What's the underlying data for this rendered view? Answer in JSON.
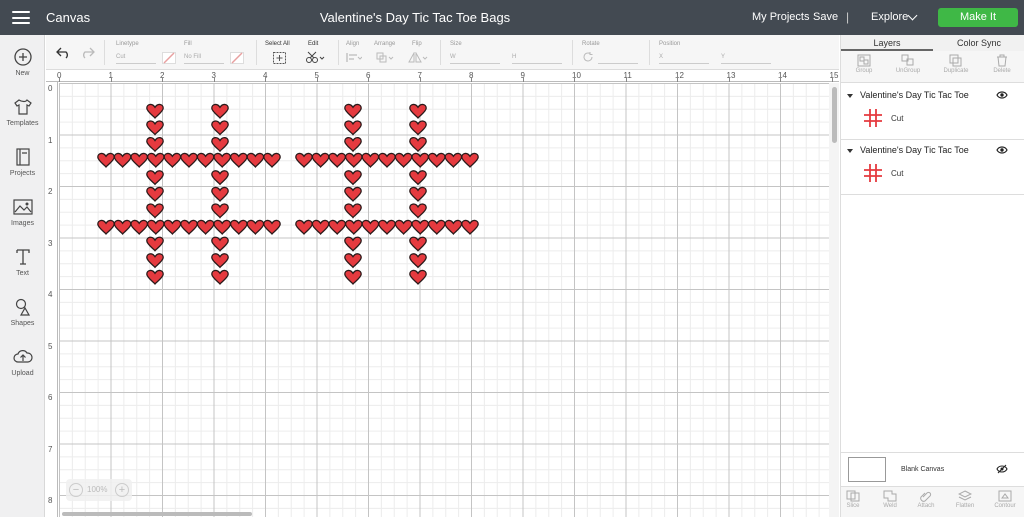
{
  "header": {
    "app_title": "Canvas",
    "project_title": "Valentine's Day Tic Tac Toe Bags",
    "my_projects": "My Projects",
    "save": "Save",
    "separator": "|",
    "explore": "Explore",
    "make_it": "Make It"
  },
  "sidebar": {
    "items": [
      {
        "label": "New",
        "icon": "plus-circle-icon"
      },
      {
        "label": "Templates",
        "icon": "shirt-icon"
      },
      {
        "label": "Projects",
        "icon": "book-icon"
      },
      {
        "label": "Images",
        "icon": "image-icon"
      },
      {
        "label": "Text",
        "icon": "text-icon"
      },
      {
        "label": "Shapes",
        "icon": "shapes-icon"
      },
      {
        "label": "Upload",
        "icon": "cloud-upload-icon"
      }
    ]
  },
  "toolbar": {
    "linetype_label": "Linetype",
    "linetype_value": "Cut",
    "fill_label": "Fill",
    "fill_value": "No Fill",
    "select_all": "Select All",
    "edit": "Edit",
    "align": "Align",
    "arrange": "Arrange",
    "flip": "Flip",
    "size": "Size",
    "size_w": "W",
    "size_h": "H",
    "rotate": "Rotate",
    "position": "Position",
    "pos_x": "X",
    "pos_y": "Y"
  },
  "rulers": {
    "top": [
      "0",
      "1",
      "2",
      "3",
      "4",
      "5",
      "6",
      "7",
      "8",
      "9",
      "10",
      "11",
      "12",
      "13",
      "14",
      "15"
    ],
    "left": [
      "0",
      "1",
      "2",
      "3",
      "4",
      "5",
      "6",
      "7",
      "8"
    ]
  },
  "zoom": {
    "minus": "−",
    "level": "100%",
    "plus": "+"
  },
  "panel": {
    "tabs": [
      "Layers",
      "Color Sync"
    ],
    "tools": [
      "Group",
      "UnGroup",
      "Duplicate",
      "Delete"
    ],
    "layers": [
      {
        "name": "Valentine's Day Tic Tac Toe",
        "operation": "Cut"
      },
      {
        "name": "Valentine's Day Tic Tac Toe",
        "operation": "Cut"
      }
    ],
    "blank_canvas": "Blank Canvas",
    "bottom_tools": [
      "Slice",
      "Weld",
      "Attach",
      "Flatten",
      "Contour"
    ]
  },
  "colors": {
    "header_bg": "#434a52",
    "make_it": "#3fb846",
    "heart_fill": "#e53a3f",
    "heart_stroke": "#2a1a1a"
  }
}
